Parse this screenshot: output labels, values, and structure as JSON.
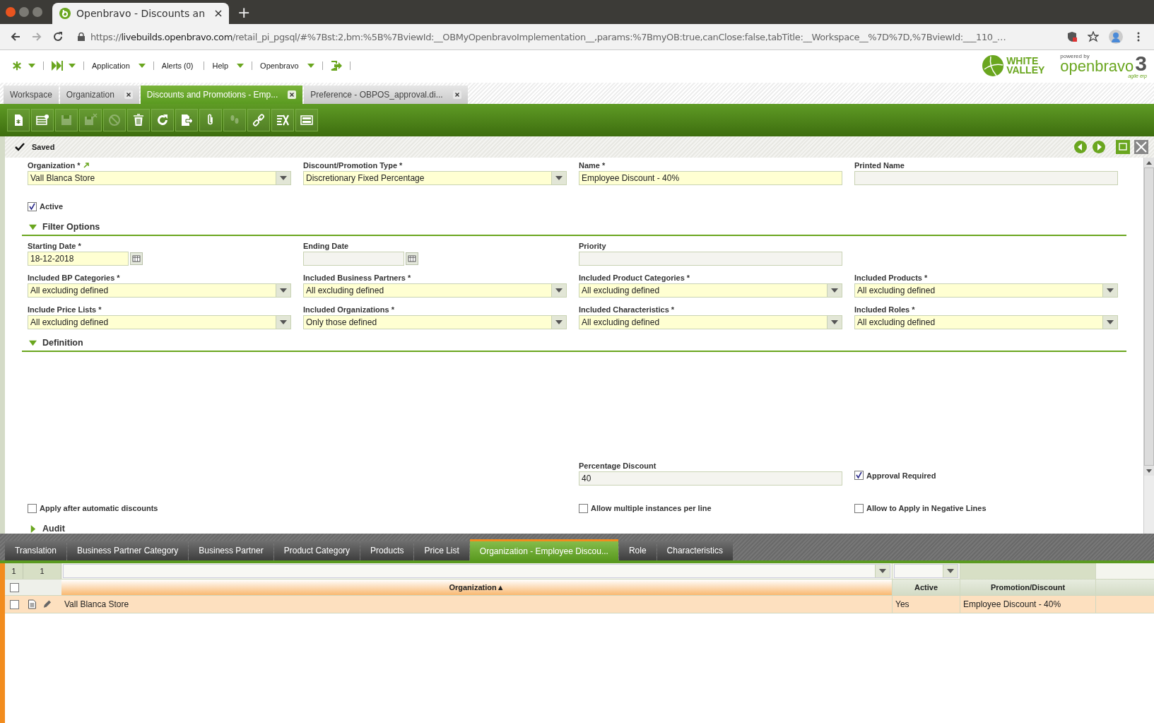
{
  "browser": {
    "tab_title": "Openbravo - Discounts an",
    "new_tab": "+",
    "url_host": "livebuilds.openbravo.com",
    "url_scheme": "https://",
    "url_path": "/retail_pi_pgsql/#%7Bst:2,bm:%5B%7BviewId:__OBMyOpenbravoImplementation__,params:%7BmyOB:true,canClose:false,tabTitle:__Workspace__%7D%7D,%7BviewId:___110_…"
  },
  "menu": [
    {
      "label": "Application"
    },
    {
      "label": "Alerts (0)"
    },
    {
      "label": "Help"
    },
    {
      "label": "Openbravo"
    }
  ],
  "logos": {
    "partner": [
      "WHITE",
      "VALLEY"
    ],
    "powered_by": "powered by",
    "product": "openbravo",
    "tagline": "agile erp",
    "version": "3"
  },
  "app_tabs": [
    {
      "label": "Workspace",
      "selected": false,
      "closable": false
    },
    {
      "label": "Organization",
      "selected": false,
      "closable": true
    },
    {
      "label": "Discounts and Promotions - Emp...",
      "selected": true,
      "closable": true
    },
    {
      "label": "Preference - OBPOS_approval.di...",
      "selected": false,
      "closable": true
    }
  ],
  "toolbar": [
    {
      "kind": "new",
      "disabled": false
    },
    {
      "kind": "new-grid",
      "disabled": false
    },
    {
      "kind": "save",
      "disabled": true
    },
    {
      "kind": "save-close",
      "disabled": true
    },
    {
      "kind": "cancel",
      "disabled": true
    },
    {
      "kind": "delete",
      "disabled": false
    },
    {
      "kind": "refresh",
      "disabled": false
    },
    {
      "kind": "export",
      "disabled": false
    },
    {
      "kind": "attach",
      "disabled": false
    },
    {
      "kind": "audit",
      "disabled": true
    },
    {
      "kind": "link",
      "disabled": false
    },
    {
      "kind": "tools",
      "disabled": false
    },
    {
      "kind": "layout",
      "disabled": false
    }
  ],
  "status": "Saved",
  "sections": [
    {
      "rows": [
        [
          {
            "kind": "combo",
            "label": "Organization *",
            "value": "Vall Blanca Store",
            "required": true,
            "link": true
          },
          {
            "kind": "combo",
            "label": "Discount/Promotion Type *",
            "value": "Discretionary Fixed Percentage",
            "required": true
          },
          {
            "kind": "text",
            "label": "Name *",
            "value": "Employee Discount - 40%",
            "required": true
          },
          {
            "kind": "text",
            "label": "Printed Name",
            "required": false
          }
        ],
        [
          {
            "kind": "checkbox",
            "label": "Active",
            "checked": true
          }
        ]
      ]
    },
    {
      "title": "Filter Options",
      "expanded": true,
      "rows": [
        [
          {
            "kind": "date",
            "label": "Starting Date *",
            "value": "18-12-2018",
            "required": true
          },
          {
            "kind": "date",
            "label": "Ending Date",
            "required": false
          },
          {
            "kind": "text",
            "label": "Priority",
            "required": false
          }
        ],
        [
          {
            "kind": "combo",
            "label": "Included BP Categories *",
            "value": "All excluding defined",
            "required": true
          },
          {
            "kind": "combo",
            "label": "Included Business Partners *",
            "value": "All excluding defined",
            "required": true
          },
          {
            "kind": "combo",
            "label": "Included Product Categories *",
            "value": "All excluding defined",
            "required": true
          },
          {
            "kind": "combo",
            "label": "Included Products *",
            "value": "All excluding defined",
            "required": true
          }
        ],
        [
          {
            "kind": "combo",
            "label": "Include Price Lists *",
            "value": "All excluding defined",
            "required": true
          },
          {
            "kind": "combo",
            "label": "Included Organizations *",
            "value": "Only those defined",
            "required": true
          },
          {
            "kind": "combo",
            "label": "Included Characteristics *",
            "value": "All excluding defined",
            "required": true
          },
          {
            "kind": "combo",
            "label": "Included Roles *",
            "value": "All excluding defined",
            "required": true
          }
        ]
      ]
    },
    {
      "title": "Definition",
      "expanded": true,
      "rows": [
        [
          {
            "kind": "blank"
          },
          {
            "kind": "blank"
          },
          {
            "kind": "text",
            "label": "Percentage Discount",
            "value": "40",
            "required": false
          },
          {
            "kind": "checkbox",
            "label": "Approval Required",
            "checked": true
          }
        ],
        [
          {
            "kind": "checkbox",
            "label": "Apply after automatic discounts",
            "checked": false
          },
          {
            "kind": "blank"
          },
          {
            "kind": "checkbox",
            "label": "Allow multiple instances per line",
            "checked": false
          },
          {
            "kind": "checkbox",
            "label": "Allow to Apply in Negative Lines",
            "checked": false
          }
        ]
      ]
    },
    {
      "title": "Audit",
      "expanded": false
    }
  ],
  "sub_tabs": [
    {
      "label": "Translation",
      "selected": false
    },
    {
      "label": "Business Partner Category",
      "selected": false
    },
    {
      "label": "Business Partner",
      "selected": false
    },
    {
      "label": "Product Category",
      "selected": false
    },
    {
      "label": "Products",
      "selected": false
    },
    {
      "label": "Price List",
      "selected": false
    },
    {
      "label": "Organization - Employee Discou...",
      "selected": true
    },
    {
      "label": "Role",
      "selected": false
    },
    {
      "label": "Characteristics",
      "selected": false
    }
  ],
  "grid": {
    "counts": [
      "1",
      "1"
    ],
    "all_checked": false,
    "sort_mark": "▲",
    "columns": [
      {
        "label": "Organization",
        "sorted": true,
        "filter": true
      },
      {
        "label": "Active",
        "sorted": false,
        "filter": true
      },
      {
        "label": "Promotion/Discount",
        "sorted": false,
        "filter": false
      }
    ],
    "rows": [
      {
        "cells": [
          "Vall Blanca Store",
          "Yes",
          "Employee Discount - 40%"
        ],
        "selected": true,
        "checked": false
      }
    ]
  }
}
